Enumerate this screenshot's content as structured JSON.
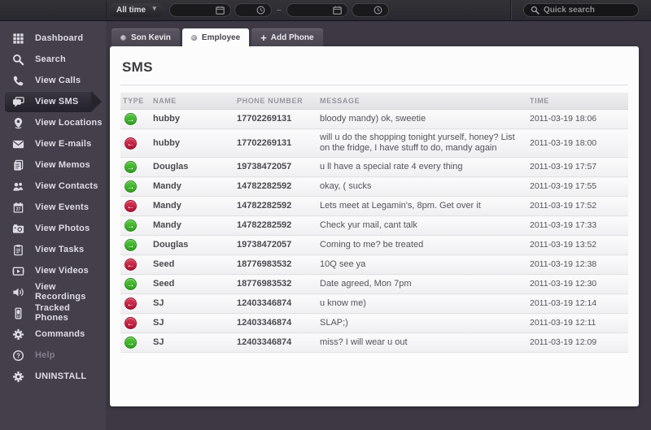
{
  "topbar": {
    "time_filter": {
      "selected": "All time"
    },
    "date_from": "",
    "time_from": "",
    "date_to": "",
    "time_to": "",
    "range_dash": "–",
    "search": {
      "placeholder": "Quick search",
      "value": ""
    }
  },
  "sidebar": {
    "items": [
      {
        "label": "Dashboard",
        "icon": "dashboard-grid-icon",
        "state": ""
      },
      {
        "label": "Search",
        "icon": "search-icon",
        "state": ""
      },
      {
        "label": "View Calls",
        "icon": "phone-icon",
        "state": ""
      },
      {
        "label": "View SMS",
        "icon": "sms-bubbles-icon",
        "state": "active"
      },
      {
        "label": "View Locations",
        "icon": "location-pin-icon",
        "state": ""
      },
      {
        "label": "View E-mails",
        "icon": "envelope-icon",
        "state": ""
      },
      {
        "label": "View Memos",
        "icon": "memo-pages-icon",
        "state": ""
      },
      {
        "label": "View Contacts",
        "icon": "contacts-icon",
        "state": ""
      },
      {
        "label": "View Events",
        "icon": "calendar-27-icon",
        "state": ""
      },
      {
        "label": "View Photos",
        "icon": "camera-icon",
        "state": ""
      },
      {
        "label": "View Tasks",
        "icon": "clipboard-icon",
        "state": ""
      },
      {
        "label": "View Videos",
        "icon": "video-icon",
        "state": ""
      },
      {
        "label": "View Recordings",
        "icon": "speaker-icon",
        "state": ""
      },
      {
        "label": "Tracked Phones",
        "icon": "mobile-phone-icon",
        "state": ""
      },
      {
        "label": "Commands",
        "icon": "gear-icon",
        "state": ""
      },
      {
        "label": "Help",
        "icon": "help-icon",
        "state": "muted"
      },
      {
        "label": "UNINSTALL",
        "icon": "gear-icon",
        "state": ""
      }
    ]
  },
  "tabs": [
    {
      "label": "Son Kevin",
      "icon": "phone-status-dot",
      "state": ""
    },
    {
      "label": "Employee",
      "icon": "phone-status-dot",
      "state": "active"
    },
    {
      "label": "Add Phone",
      "icon": "plus-icon",
      "state": ""
    }
  ],
  "main": {
    "title": "SMS",
    "table": {
      "headers": [
        "TYPE",
        "NAME",
        "PHONE NUMBER",
        "MESSAGE",
        "TIME"
      ],
      "rows": [
        {
          "type": "outgoing",
          "name": "hubby",
          "phone": "17702269131",
          "message": "bloody mandy) ok, sweetie",
          "time": "2011-03-19 18:06"
        },
        {
          "type": "incoming",
          "name": "hubby",
          "phone": "17702269131",
          "message": "will u do the shopping tonight yurself, honey? List on the fridge, I have stuff to do, mandy again",
          "time": "2011-03-19 18:00"
        },
        {
          "type": "outgoing",
          "name": "Douglas",
          "phone": "19738472057",
          "message": "u ll have a special rate 4 every thing",
          "time": "2011-03-19 17:57"
        },
        {
          "type": "outgoing",
          "name": "Mandy",
          "phone": "14782282592",
          "message": "okay, ( sucks",
          "time": "2011-03-19 17:55"
        },
        {
          "type": "incoming",
          "name": "Mandy",
          "phone": "14782282592",
          "message": "Lets meet at Legamin's, 8pm. Get over it",
          "time": "2011-03-19 17:52"
        },
        {
          "type": "outgoing",
          "name": "Mandy",
          "phone": "14782282592",
          "message": "Check yur mail, cant talk",
          "time": "2011-03-19 17:33"
        },
        {
          "type": "outgoing",
          "name": "Douglas",
          "phone": "19738472057",
          "message": "Coming to me? be treated",
          "time": "2011-03-19 13:52"
        },
        {
          "type": "incoming",
          "name": "Seed",
          "phone": "18776983532",
          "message": "10Q see ya",
          "time": "2011-03-19 12:38"
        },
        {
          "type": "outgoing",
          "name": "Seed",
          "phone": "18776983532",
          "message": "Date agreed, Mon 7pm",
          "time": "2011-03-19 12:30"
        },
        {
          "type": "incoming",
          "name": "SJ",
          "phone": "12403346874",
          "message": "u know me)",
          "time": "2011-03-19 12:14"
        },
        {
          "type": "incoming",
          "name": "SJ",
          "phone": "12403346874",
          "message": "SLAP;)",
          "time": "2011-03-19 12:11"
        },
        {
          "type": "outgoing",
          "name": "SJ",
          "phone": "12403346874",
          "message": "miss? I will wear u out",
          "time": "2011-03-19 12:09"
        }
      ]
    }
  },
  "colors": {
    "outgoing_green": "#3fb32b",
    "incoming_red": "#b01232",
    "sidebar_bg": "#453f4c",
    "topbar_bg": "#2e2d30",
    "panel_bg": "#fcfcfd"
  }
}
